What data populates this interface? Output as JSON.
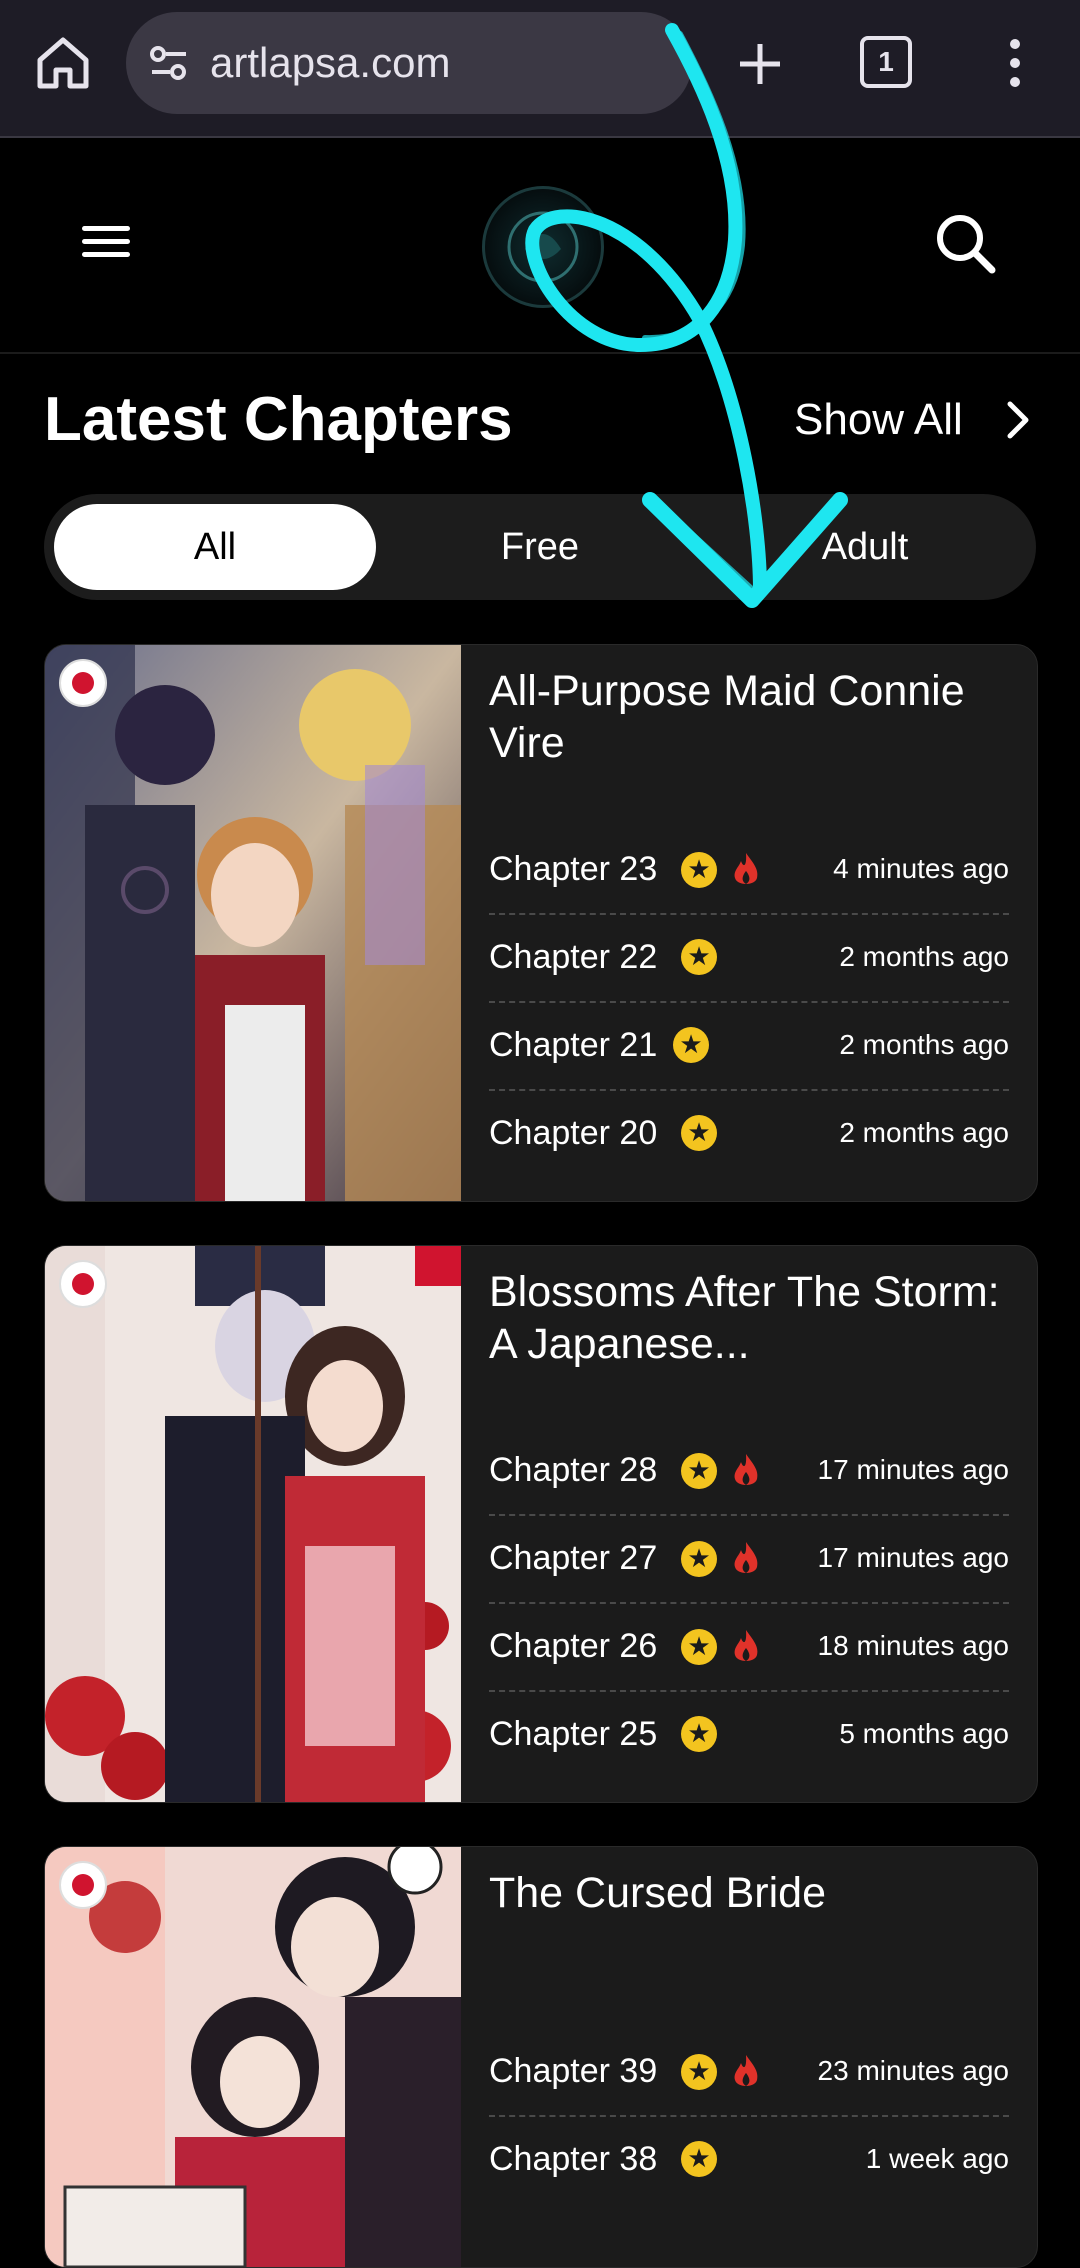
{
  "browser": {
    "url": "artlapsa.com",
    "tab_count": "1"
  },
  "site": {
    "section_title": "Latest Chapters",
    "show_all_label": "Show All",
    "filters": [
      {
        "label": "All",
        "active": true
      },
      {
        "label": "Free",
        "active": false
      },
      {
        "label": "Adult",
        "active": false
      }
    ]
  },
  "colors": {
    "accent_star": "#f3c41f",
    "fire": "#e0322a",
    "annotation": "#1ee6f0"
  },
  "manga": [
    {
      "title": "All-Purpose Maid Connie Vire",
      "chapters": [
        {
          "name": "Chapter 23",
          "star": true,
          "hot": true,
          "time": "4 minutes ago"
        },
        {
          "name": "Chapter 22",
          "star": true,
          "hot": false,
          "time": "2 months ago"
        },
        {
          "name": "Chapter 21",
          "star": true,
          "hot": false,
          "time": "2 months ago"
        },
        {
          "name": "Chapter 20",
          "star": true,
          "hot": false,
          "time": "2 months ago"
        }
      ]
    },
    {
      "title": "Blossoms After The Storm: A Japanese...",
      "chapters": [
        {
          "name": "Chapter 28",
          "star": true,
          "hot": true,
          "time": "17 minutes ago"
        },
        {
          "name": "Chapter 27",
          "star": true,
          "hot": true,
          "time": "17 minutes ago"
        },
        {
          "name": "Chapter 26",
          "star": true,
          "hot": true,
          "time": "18 minutes ago"
        },
        {
          "name": "Chapter 25",
          "star": true,
          "hot": false,
          "time": "5 months ago"
        }
      ]
    },
    {
      "title": "The Cursed Bride",
      "chapters": [
        {
          "name": "Chapter 39",
          "star": true,
          "hot": true,
          "time": "23 minutes ago"
        },
        {
          "name": "Chapter 38",
          "star": true,
          "hot": false,
          "time": "1 week ago"
        }
      ]
    }
  ]
}
